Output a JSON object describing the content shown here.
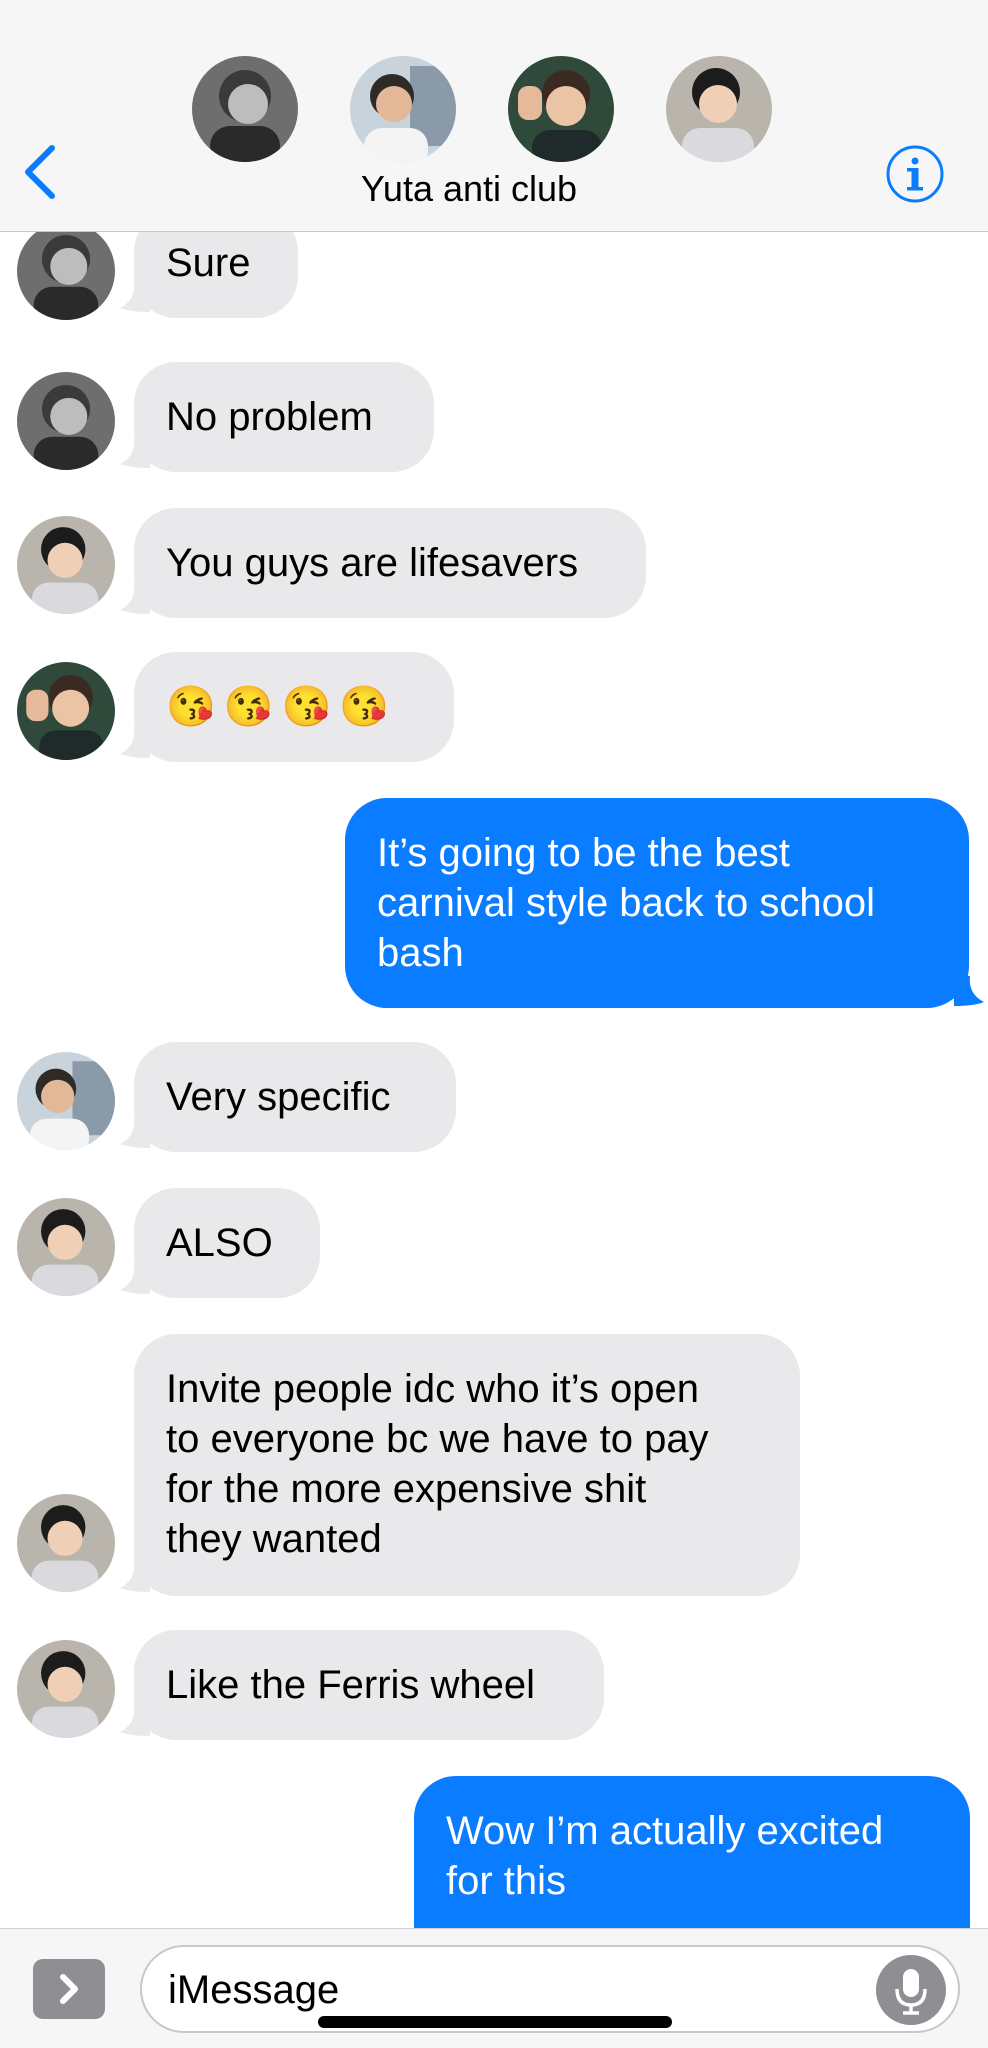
{
  "header": {
    "group_name": "Yuta anti club",
    "participants": [
      {
        "name": "participant-1",
        "style": "monochrome"
      },
      {
        "name": "participant-2",
        "style": "outdoor"
      },
      {
        "name": "participant-3",
        "style": "selfie"
      },
      {
        "name": "participant-4",
        "style": "smiling"
      }
    ],
    "back_icon": "chevron-left-icon",
    "info_icon": "info-icon"
  },
  "messages": [
    {
      "from": "participant-1",
      "direction": "incoming",
      "text": "Sure"
    },
    {
      "from": "participant-1",
      "direction": "incoming",
      "text": "No problem"
    },
    {
      "from": "participant-4",
      "direction": "incoming",
      "text": "You guys are lifesavers"
    },
    {
      "from": "participant-3",
      "direction": "incoming",
      "text": "😘😘😘😘"
    },
    {
      "from": "me",
      "direction": "outgoing",
      "text": "It’s going to be the best\ncarnival style back to school\nbash"
    },
    {
      "from": "participant-2",
      "direction": "incoming",
      "text": "Very specific"
    },
    {
      "from": "participant-4",
      "direction": "incoming",
      "text": "ALSO"
    },
    {
      "from": "participant-4",
      "direction": "incoming",
      "text": "Invite people idc who it’s open\nto everyone bc we have to pay\nfor the more expensive shit\nthey wanted"
    },
    {
      "from": "participant-4",
      "direction": "incoming",
      "text": "Like the Ferris wheel"
    },
    {
      "from": "me",
      "direction": "outgoing",
      "text": "Wow I’m actually excited\nfor this"
    }
  ],
  "input": {
    "placeholder": "iMessage",
    "apps_icon": "chevron-right-icon",
    "mic_icon": "microphone-icon"
  },
  "colors": {
    "incoming_bubble": "#e9e9eb",
    "outgoing_bubble": "#0a7cff",
    "accent": "#0a7cff"
  }
}
